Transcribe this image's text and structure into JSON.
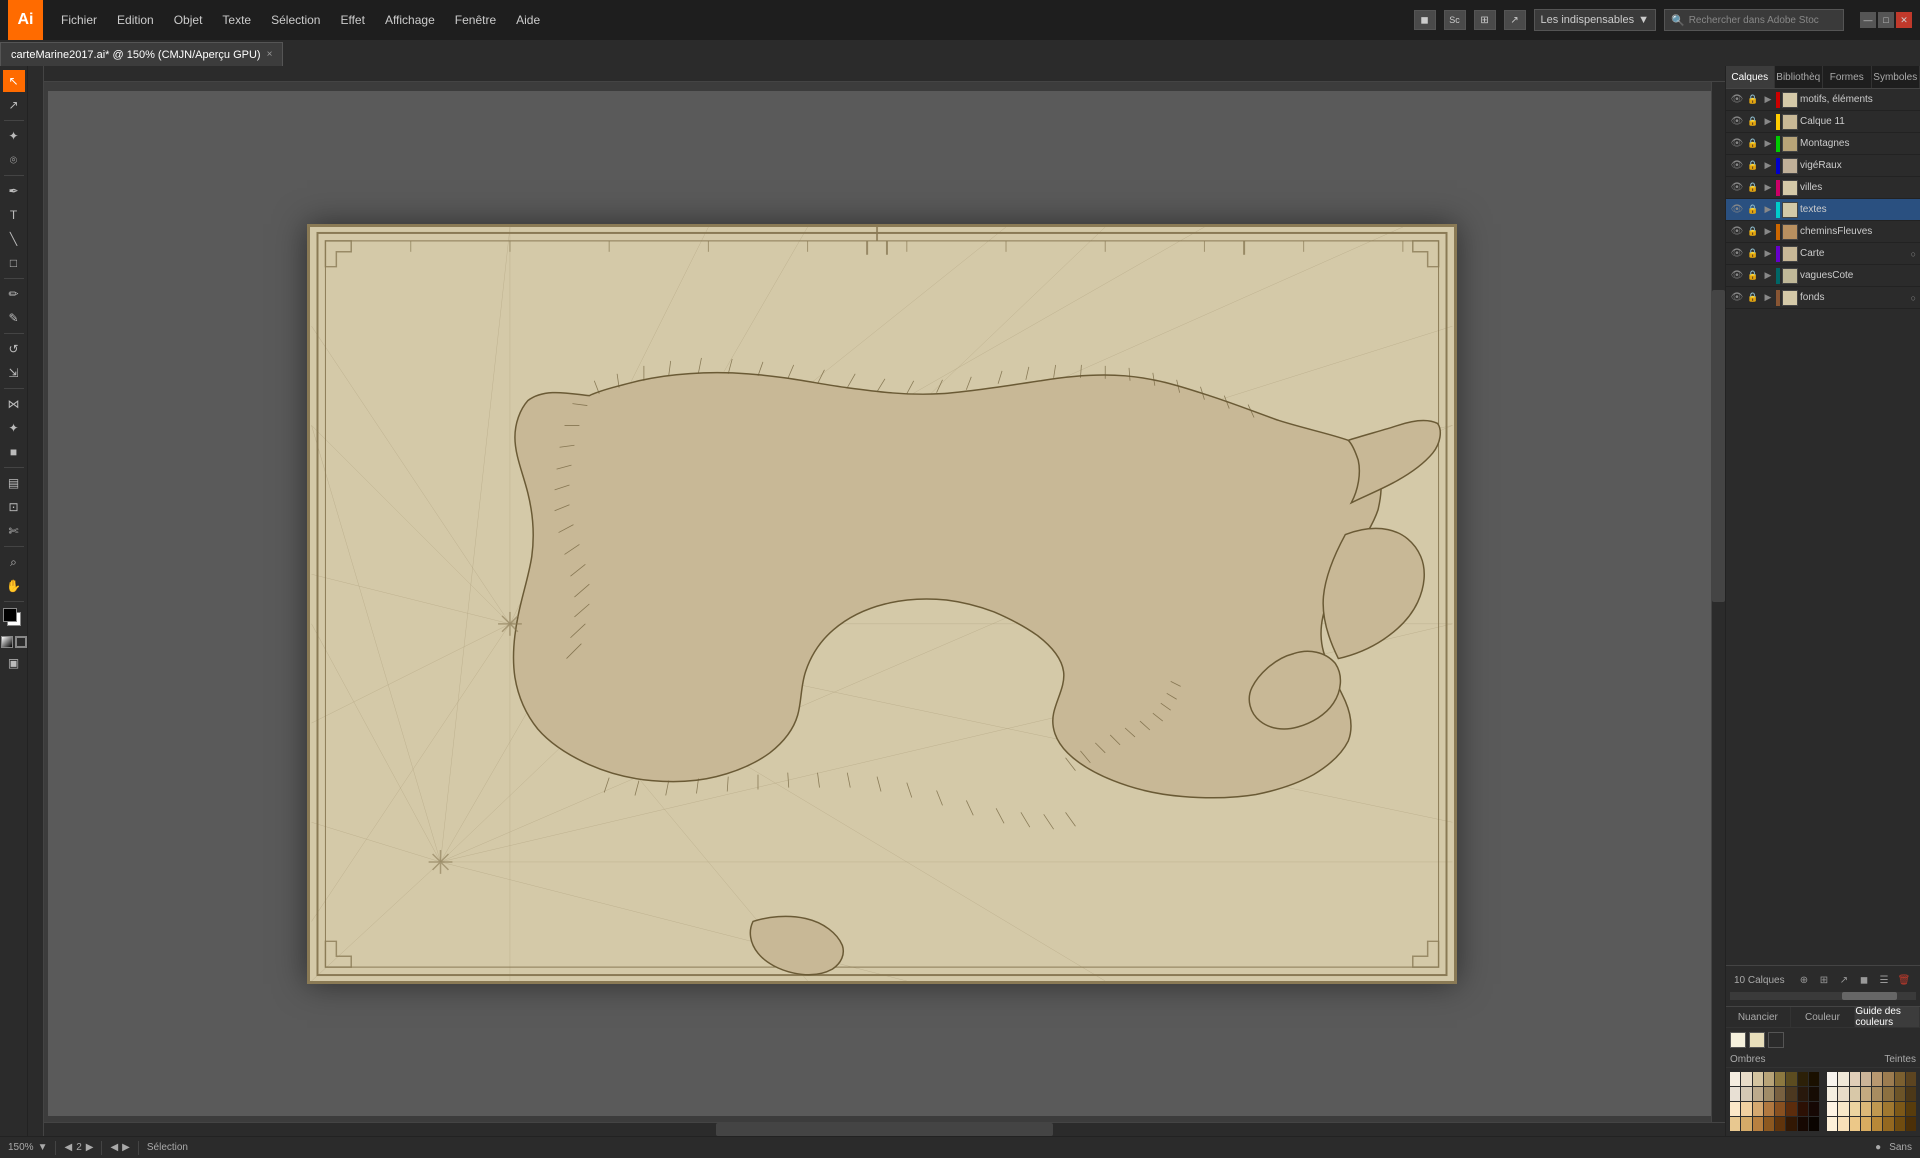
{
  "app": {
    "logo": "Ai",
    "logo_bg": "#FF6B00"
  },
  "menu": {
    "items": [
      "Fichier",
      "Edition",
      "Objet",
      "Texte",
      "Sélection",
      "Effet",
      "Affichage",
      "Fenêtre",
      "Aide"
    ],
    "workspace_dropdown": "Les indispensables",
    "search_placeholder": "Rechercher dans Adobe Stoc"
  },
  "window_controls": {
    "minimize": "—",
    "maximize": "□",
    "close": "✕"
  },
  "toolbar_icons": [
    "◼",
    "Sc",
    "⊞",
    "↗"
  ],
  "tab": {
    "title": "carteMarine2017.ai* @ 150% (CMJN/Aperçu GPU)",
    "close": "×"
  },
  "tools": [
    {
      "name": "selection-tool",
      "icon": "↖"
    },
    {
      "name": "direct-selection-tool",
      "icon": "↗"
    },
    {
      "name": "magic-wand-tool",
      "icon": "✦"
    },
    {
      "name": "lasso-tool",
      "icon": "⌘"
    },
    {
      "name": "pen-tool",
      "icon": "✒"
    },
    {
      "name": "type-tool",
      "icon": "T"
    },
    {
      "name": "line-tool",
      "icon": "╲"
    },
    {
      "name": "rectangle-tool",
      "icon": "□"
    },
    {
      "name": "paintbrush-tool",
      "icon": "✏"
    },
    {
      "name": "pencil-tool",
      "icon": "✎"
    },
    {
      "name": "rotate-tool",
      "icon": "↺"
    },
    {
      "name": "scale-tool",
      "icon": "⇲"
    },
    {
      "name": "blend-tool",
      "icon": "⋈"
    },
    {
      "name": "eyedropper-tool",
      "icon": "✦"
    },
    {
      "name": "gradient-tool",
      "icon": "■"
    },
    {
      "name": "graph-tool",
      "icon": "▤"
    },
    {
      "name": "artboard-tool",
      "icon": "⊡"
    },
    {
      "name": "slice-tool",
      "icon": "✄"
    },
    {
      "name": "zoom-tool",
      "icon": "⌕"
    },
    {
      "name": "hand-tool",
      "icon": "✋"
    }
  ],
  "tool_colors": {
    "foreground": "#000000",
    "background": "#ffffff",
    "stroke": "#000000",
    "fill_none": "none"
  },
  "panel": {
    "tabs": [
      {
        "id": "calques",
        "label": "Calques"
      },
      {
        "id": "bibliotheq",
        "label": "Bibliothèq"
      },
      {
        "id": "formes",
        "label": "Formes"
      },
      {
        "id": "symboles",
        "label": "Symboles"
      }
    ],
    "active_tab": "calques",
    "layers": [
      {
        "name": "motifs, éléments",
        "color": "#cc0000",
        "visible": true,
        "locked": true,
        "expanded": false,
        "count": ""
      },
      {
        "name": "Calque 11",
        "color": "#ffcc00",
        "visible": true,
        "locked": true,
        "expanded": false,
        "count": ""
      },
      {
        "name": "Montagnes",
        "color": "#00cc00",
        "visible": true,
        "locked": true,
        "expanded": false,
        "count": ""
      },
      {
        "name": "vigéRaux",
        "color": "#0000cc",
        "visible": true,
        "locked": true,
        "expanded": false,
        "count": ""
      },
      {
        "name": "villes",
        "color": "#cc0066",
        "visible": true,
        "locked": true,
        "expanded": false,
        "count": ""
      },
      {
        "name": "textes",
        "color": "#00cccc",
        "visible": true,
        "locked": true,
        "expanded": false,
        "count": "",
        "active": true
      },
      {
        "name": "cheminsFleuves",
        "color": "#cc6600",
        "visible": true,
        "locked": true,
        "expanded": false,
        "count": ""
      },
      {
        "name": "Carte",
        "color": "#6600cc",
        "visible": true,
        "locked": true,
        "expanded": false,
        "count": "◯"
      },
      {
        "name": "vaguesCote",
        "color": "#006666",
        "visible": true,
        "locked": true,
        "expanded": false,
        "count": ""
      },
      {
        "name": "fonds",
        "color": "#885533",
        "visible": true,
        "locked": true,
        "expanded": false,
        "count": "◯"
      }
    ],
    "layers_count": "10 Calques"
  },
  "color_panel": {
    "tabs": [
      "Nuancier",
      "Couleur",
      "Guide des couleurs"
    ],
    "active_tab": "Guide des couleurs",
    "swatches": [
      {
        "color": "#f5f0dc",
        "label": "swatch1"
      },
      {
        "color": "#e8debb",
        "label": "swatch2"
      },
      {
        "color": "#2b2b2b",
        "label": "swatch3"
      }
    ],
    "shadow_label": "Ombres",
    "tints_label": "Teintes",
    "swatch_rows": [
      [
        "#f5ede0",
        "#e8dcc8",
        "#d4c4a0",
        "#b8a478",
        "#8c7840",
        "#5c4c20",
        "#2c2008",
        "#1a1000"
      ],
      [
        "#e8e0d4",
        "#d4c8b4",
        "#bcaa8c",
        "#a08c68",
        "#786040",
        "#4c3820",
        "#28180c",
        "#160c04"
      ],
      [
        "#d4c8b8",
        "#c0b098",
        "#a89070",
        "#8c7050",
        "#685030",
        "#3c2c14",
        "#1c1008",
        "#0e0804"
      ],
      [
        "#fce8c8",
        "#f0d0a0",
        "#d4a870",
        "#b07840",
        "#885020",
        "#5c2c0c",
        "#2c1004",
        "#160804"
      ],
      [
        "#f0d8b0",
        "#e0c090",
        "#c89c60",
        "#a07030",
        "#784810",
        "#4c2808",
        "#200e02",
        "#100602"
      ],
      [
        "#e8c890",
        "#d4aa68",
        "#b88040",
        "#8c5820",
        "#60340c",
        "#321804",
        "#160802",
        "#0a0400"
      ],
      [
        "#deb880",
        "#c49858",
        "#a87030",
        "#7c4c18",
        "#502c08",
        "#281402",
        "#100600",
        "#080200"
      ]
    ]
  },
  "status_bar": {
    "zoom": "150%",
    "nav_prev": "◀",
    "nav_next": "▶",
    "page": "2",
    "page_controls": "◀ ▶",
    "tool_name": "Sélection",
    "doc_info": "Sans",
    "progress_dot": "●"
  }
}
